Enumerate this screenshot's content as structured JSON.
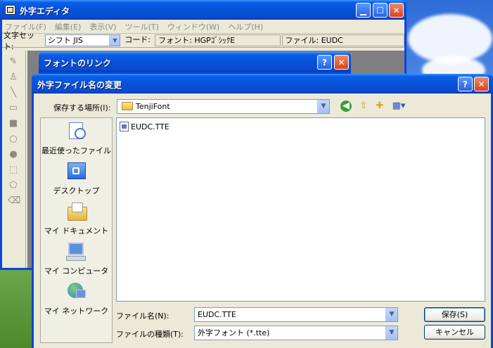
{
  "editor": {
    "title": "外字エディタ",
    "menu": [
      "ファイル(F)",
      "編集(E)",
      "表示(V)",
      "ツール(T)",
      "ウィンドウ(W)",
      "ヘルプ(H)"
    ],
    "charset_label": "文字セット:",
    "charset_value": "シフト JIS",
    "code_label": "コード:",
    "font_label": "フォント: HGPｺﾞｼｯｸE",
    "file_label": "ファイル: EUDC"
  },
  "link_dialog": {
    "title": "フォントのリンク"
  },
  "rename_dialog": {
    "title": "外字ファイル名の変更",
    "lookin_label": "保存する場所(I):",
    "lookin_value": "TenjiFont",
    "places": [
      "最近使ったファイル",
      "デスクトップ",
      "マイ ドキュメント",
      "マイ コンピュータ",
      "マイ ネットワーク"
    ],
    "files": [
      "EUDC.TTE"
    ],
    "filename_label": "ファイル名(N):",
    "filename_value": "EUDC.TTE",
    "filetype_label": "ファイルの種類(T):",
    "filetype_value": "外字フォント (*.tte)",
    "save_button": "保存(S)",
    "cancel_button": "キャンセル"
  },
  "colors": {
    "titlebar": "#0a4cce",
    "dialog_bg": "#ece9d8",
    "input_border": "#7f9db9"
  }
}
